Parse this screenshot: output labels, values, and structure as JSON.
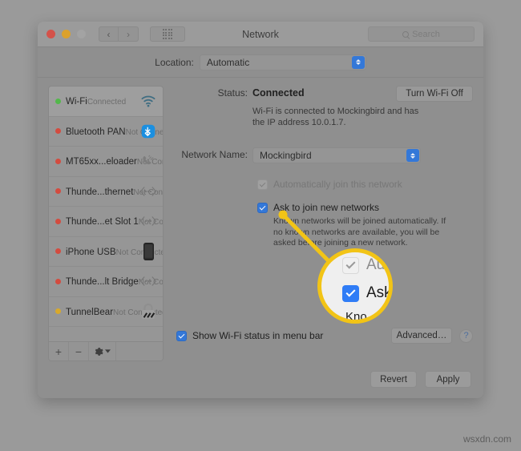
{
  "window": {
    "title": "Network",
    "traffic_lights": [
      "close",
      "minimize",
      "zoom"
    ],
    "nav_back": "‹",
    "nav_forward": "›",
    "grid_button": "show-all-icon"
  },
  "search": {
    "placeholder": "Search",
    "icon": "search-icon"
  },
  "location": {
    "label": "Location:",
    "value": "Automatic"
  },
  "sidebar": {
    "services": [
      {
        "name": "Wi-Fi",
        "status": "Connected",
        "dot": "green",
        "icon": "wifi-icon",
        "selected": true
      },
      {
        "name": "Bluetooth PAN",
        "status": "Not Connected",
        "dot": "red",
        "icon": "bluetooth-icon",
        "selected": false
      },
      {
        "name": "MT65xx...eloader",
        "status": "Not Configured",
        "dot": "red",
        "icon": "modem-icon",
        "selected": false
      },
      {
        "name": "Thunde...thernet",
        "status": "Not Connected",
        "dot": "red",
        "icon": "thunderbolt-icon",
        "selected": false
      },
      {
        "name": "Thunde...et Slot 1",
        "status": "Not Connected",
        "dot": "red",
        "icon": "thunderbolt-icon",
        "selected": false
      },
      {
        "name": "iPhone USB",
        "status": "Not Connected",
        "dot": "red",
        "icon": "iphone-icon",
        "selected": false
      },
      {
        "name": "Thunde...lt Bridge",
        "status": "Not Connected",
        "dot": "red",
        "icon": "thunderbolt-icon",
        "selected": false
      },
      {
        "name": "TunnelBear",
        "status": "Not Connected",
        "dot": "yellow",
        "icon": "vpn-lock-icon",
        "selected": false
      }
    ],
    "footer": {
      "add": "+",
      "remove": "−",
      "actions": "gear-icon"
    }
  },
  "main": {
    "status_label": "Status:",
    "status_value": "Connected",
    "turn_off_button": "Turn Wi-Fi Off",
    "status_description": "Wi-Fi is connected to Mockingbird and has the IP address 10.0.1.7.",
    "network_name_label": "Network Name:",
    "network_name_value": "Mockingbird",
    "auto_join": {
      "label": "Automatically join this network",
      "checked": true,
      "enabled": false
    },
    "ask_join": {
      "label": "Ask to join new networks",
      "checked": true,
      "enabled": true
    },
    "ask_join_hint": "Known networks will be joined automatically. If no known networks are available, you will be asked before joining a new network.",
    "show_status": {
      "label": "Show Wi-Fi status in menu bar",
      "checked": true
    },
    "advanced_button": "Advanced…",
    "help_button": "?"
  },
  "footer": {
    "revert": "Revert",
    "apply": "Apply"
  },
  "callout": {
    "accent_color": "#f2c416",
    "magnified": {
      "row_a": "Au",
      "row_b": "Ask",
      "row_c": "Kno"
    }
  },
  "watermark": "wsxdn.com"
}
